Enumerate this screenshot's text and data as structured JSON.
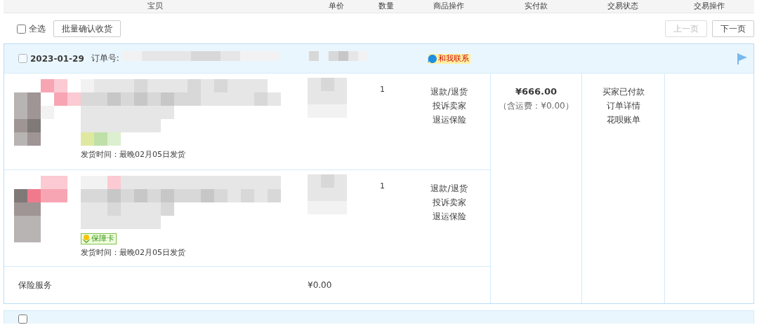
{
  "columns": [
    "宝贝",
    "单价",
    "数量",
    "商品操作",
    "实付款",
    "交易状态",
    "交易操作"
  ],
  "toolbar": {
    "select_all": {
      "label": "全选",
      "checked": false
    },
    "bulk_button": "批量确认收货",
    "prev_button": {
      "label": "上一页",
      "disabled": true
    },
    "next_button": {
      "label": "下一页",
      "disabled": false
    }
  },
  "order": {
    "checked": false,
    "date": "2023-01-29",
    "order_no_label": "订单号:",
    "contact": "和我联系",
    "items": [
      {
        "quantity": "1",
        "ship_time": "发货时间：最晚02月05日发货",
        "actions": [
          "退款/退货",
          "投诉卖家",
          "退运保险"
        ]
      },
      {
        "quantity": "1",
        "badge": "保障卡",
        "ship_time": "发货时间：最晚02月05日发货",
        "actions": [
          "退款/退货",
          "投诉卖家",
          "退运保险"
        ]
      }
    ],
    "insurance": {
      "label": "保险服务",
      "price": "¥0.00"
    },
    "total": "¥666.00",
    "shipping": "（含运费：¥0.00）",
    "status_links": [
      "买家已付款",
      "订单详情",
      "花呗账单"
    ]
  },
  "next_order": {
    "checked": false
  }
}
